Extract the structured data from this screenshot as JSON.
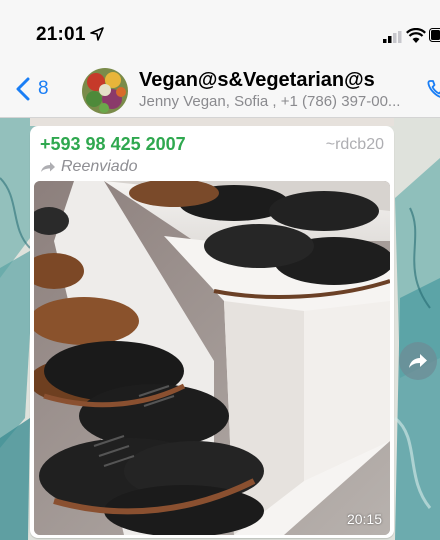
{
  "status_bar": {
    "time": "21:01",
    "icons": [
      "location-arrow-icon",
      "signal-icon",
      "wifi-icon",
      "battery-icon"
    ]
  },
  "header": {
    "back_count": "8",
    "group_name": "Vegan@s&Vegetarian@s",
    "members": "Jenny Vegan, Sofia , +1 (786) 397-00...",
    "accent_color": "#1a7ef5"
  },
  "message": {
    "sender_phone": "+593 98 425 2007",
    "sender_alias": "~rdcb20",
    "forwarded_label": "Reenviado",
    "time": "20:15",
    "sender_color": "#2fa84f",
    "image_description_icon": "shoes-photo"
  }
}
